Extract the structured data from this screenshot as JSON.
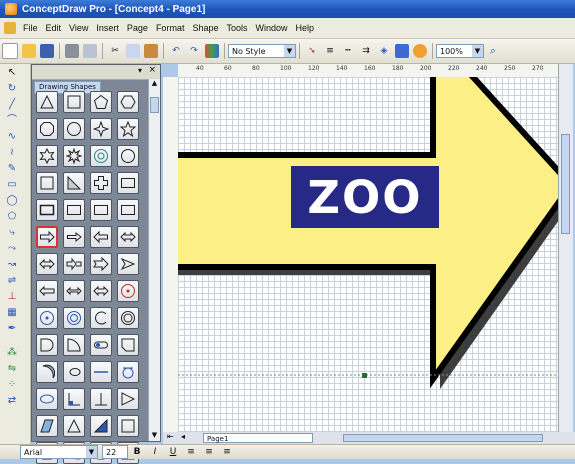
{
  "window": {
    "title": "ConceptDraw Pro - [Concept4 - Page1]"
  },
  "menu": [
    "File",
    "Edit",
    "View",
    "Insert",
    "Page",
    "Format",
    "Shape",
    "Tools",
    "Window",
    "Help"
  ],
  "toolbar": {
    "style_value": "No Style",
    "zoom_value": "100%"
  },
  "shapes_panel": {
    "tab_label": "Drawing Shapes"
  },
  "canvas": {
    "arrow_label": "ZOO",
    "arrow_fill": "#fcef86",
    "label_bg": "#262a86",
    "label_color": "#ffffff"
  },
  "ruler_h": [
    "40",
    "60",
    "80",
    "100",
    "120",
    "140",
    "160",
    "180",
    "200",
    "220",
    "240",
    "250",
    "270"
  ],
  "page_tab": "Page1",
  "statusbar": {
    "font_value": "Arial",
    "size_value": "22"
  }
}
